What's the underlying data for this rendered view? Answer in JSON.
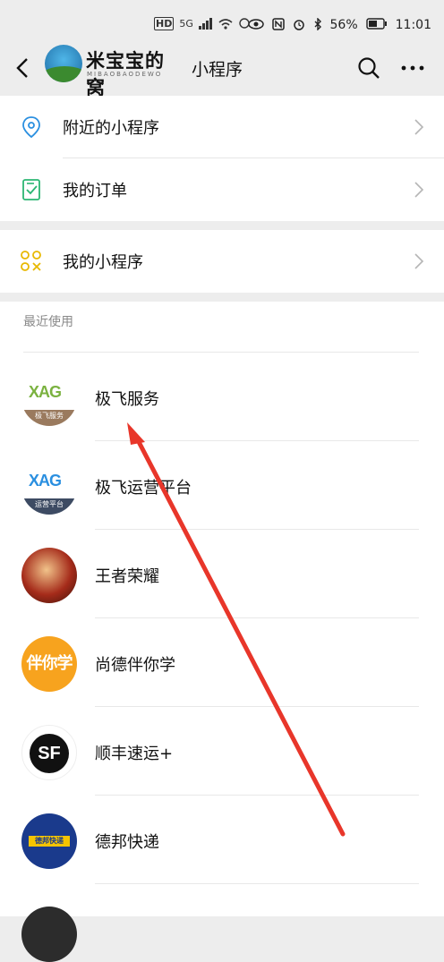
{
  "status_bar": {
    "left_hd": "HD",
    "left_5g": "5G",
    "battery": "56%",
    "time": "11:01"
  },
  "nav": {
    "logo_title": "米宝宝的窝",
    "logo_sub": "MIBAOBAODEWO",
    "title": "小程序"
  },
  "menu": {
    "nearby": "附近的小程序",
    "orders": "我的订单",
    "mine": "我的小程序"
  },
  "recent": {
    "header": "最近使用",
    "apps": [
      {
        "name": "极飞服务",
        "icon_text": "XAG",
        "icon_band": "极飞服务"
      },
      {
        "name": "极飞运营平台",
        "icon_text": "XAG",
        "icon_band": "运营平台"
      },
      {
        "name": "王者荣耀"
      },
      {
        "name": "尚德伴你学",
        "icon_text": "伴你学"
      },
      {
        "name": "顺丰速运+",
        "icon_text": "SF"
      },
      {
        "name": "德邦快递",
        "icon_text": "德邦快递"
      }
    ]
  },
  "colors": {
    "page_bg": "#ededed",
    "accent_blue": "#2a8fe0",
    "accent_green": "#2bb673",
    "accent_yellow": "#e8b800",
    "arrow_red": "#e8362a"
  }
}
